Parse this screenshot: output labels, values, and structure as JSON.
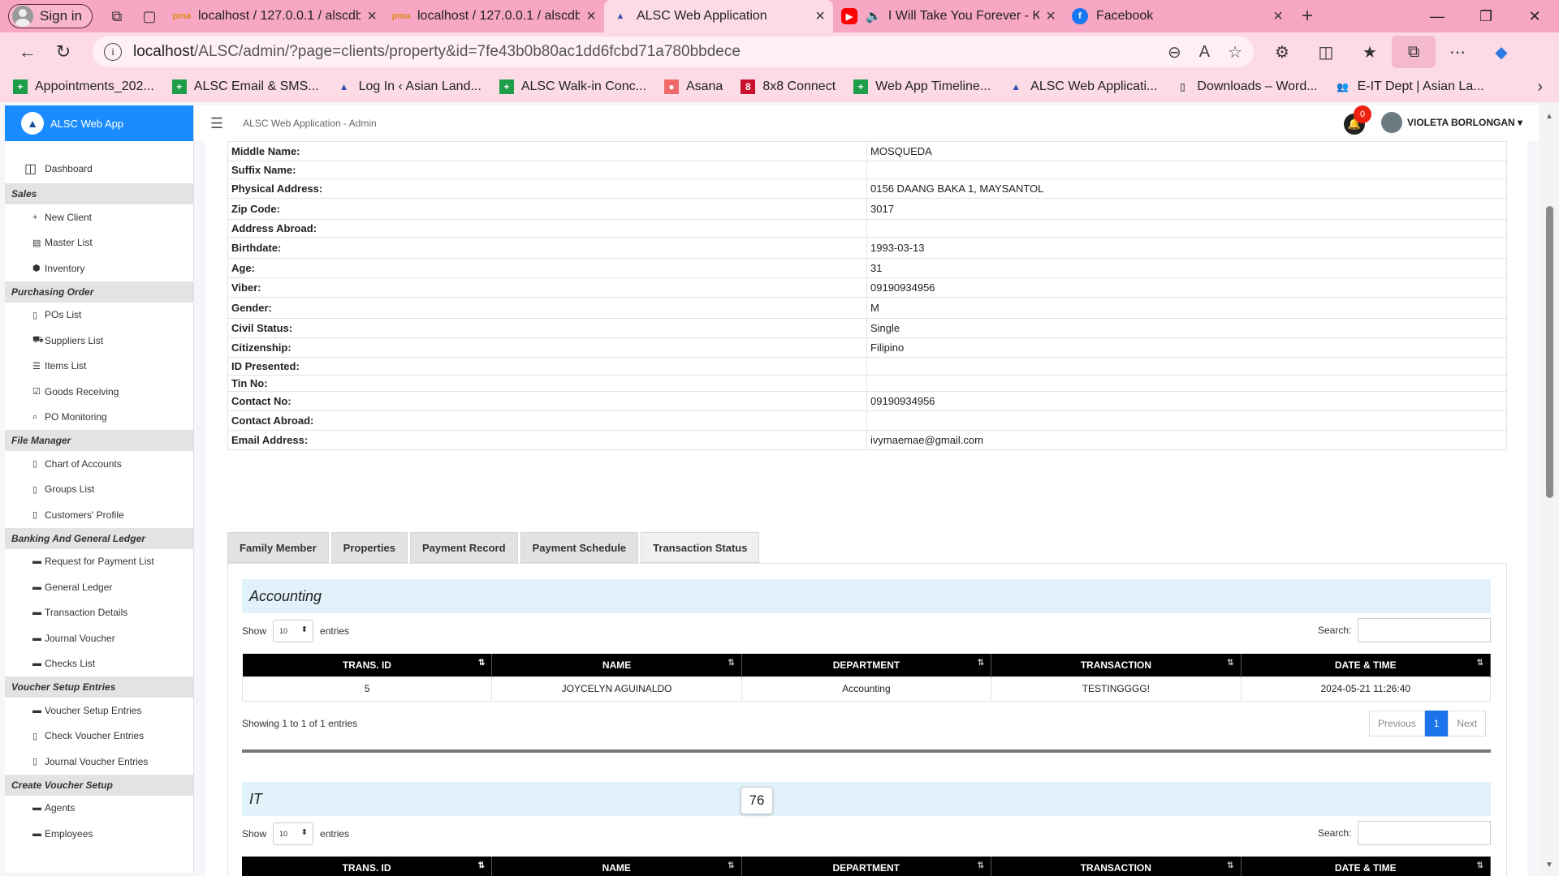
{
  "browser": {
    "signin_label": "Sign in",
    "tabs": [
      {
        "title": "localhost / 127.0.0.1 / alscdb /",
        "icon": "pma-icon"
      },
      {
        "title": "localhost / 127.0.0.1 / alscdb /",
        "icon": "pma-icon"
      },
      {
        "title": "ALSC Web Application",
        "icon": "alsc-icon",
        "active": true
      },
      {
        "title": "I Will Take You Forever - K",
        "icon": "youtube-icon"
      },
      {
        "title": "Facebook",
        "icon": "facebook-icon"
      }
    ],
    "url_host": "localhost",
    "url_path": "/ALSC/admin/?page=clients/property&id=7fe43b0b80ac1dd6fcbd71a780bbdece",
    "bookmarks": [
      {
        "label": "Appointments_202...",
        "color": "#1e9e48",
        "glyph": "+"
      },
      {
        "label": "ALSC Email & SMS...",
        "color": "#1e9e48",
        "glyph": "+"
      },
      {
        "label": "Log In ‹ Asian Land...",
        "color": "#3a4fb0",
        "glyph": "▲"
      },
      {
        "label": "ALSC Walk-in Conc...",
        "color": "#1e9e48",
        "glyph": "+"
      },
      {
        "label": "Asana",
        "color": "#f06a6a",
        "glyph": "●"
      },
      {
        "label": "8x8 Connect",
        "color": "#c8102e",
        "glyph": "8"
      },
      {
        "label": "Web App Timeline...",
        "color": "#1e9e48",
        "glyph": "+"
      },
      {
        "label": "ALSC Web Applicati...",
        "color": "#3a4fb0",
        "glyph": "▲"
      },
      {
        "label": "Downloads – Word...",
        "color": "#666",
        "glyph": "▯"
      },
      {
        "label": "E-IT Dept | Asian La...",
        "color": "#4a66d8",
        "glyph": "👥"
      }
    ]
  },
  "app": {
    "brand": "ALSC Web App",
    "top_title": "ALSC Web Application - Admin",
    "notif_count": "0",
    "user_name": "VIOLETA BORLONGAN ▾"
  },
  "sidebar": {
    "dashboard": "Dashboard",
    "sections": [
      {
        "title": "Sales",
        "items": [
          {
            "label": "New Client",
            "icon": "+"
          },
          {
            "label": "Master List",
            "icon": "▤"
          },
          {
            "label": "Inventory",
            "icon": "⬢"
          }
        ]
      },
      {
        "title": "Purchasing Order",
        "items": [
          {
            "label": "POs List",
            "icon": "▯"
          },
          {
            "label": "Suppliers List",
            "icon": "⛟"
          },
          {
            "label": "Items List",
            "icon": "☰"
          },
          {
            "label": "Goods Receiving",
            "icon": "☑"
          },
          {
            "label": "PO Monitoring",
            "icon": "⌕"
          }
        ]
      },
      {
        "title": "File Manager",
        "items": [
          {
            "label": "Chart of Accounts",
            "icon": "▯"
          },
          {
            "label": "Groups List",
            "icon": "▯"
          },
          {
            "label": "Customers' Profile",
            "icon": "▯"
          }
        ]
      },
      {
        "title": "Banking And General Ledger",
        "items": [
          {
            "label": "Request for Payment List",
            "icon": "▬"
          },
          {
            "label": "General Ledger",
            "icon": "▬"
          },
          {
            "label": "Transaction Details",
            "icon": "▬"
          },
          {
            "label": "Journal Voucher",
            "icon": "▬"
          },
          {
            "label": "Checks List",
            "icon": "▬"
          }
        ]
      },
      {
        "title": "Voucher Setup Entries",
        "items": [
          {
            "label": "Voucher Setup Entries",
            "icon": "▬"
          },
          {
            "label": "Check Voucher Entries",
            "icon": "▯"
          },
          {
            "label": "Journal Voucher Entries",
            "icon": "▯"
          }
        ]
      },
      {
        "title": "Create Voucher Setup",
        "items": [
          {
            "label": "Agents",
            "icon": "▬"
          },
          {
            "label": "Employees",
            "icon": "▬"
          }
        ]
      }
    ]
  },
  "client_details": [
    {
      "label": "Middle Name:",
      "value": "MOSQUEDA"
    },
    {
      "label": "Suffix Name:",
      "value": ""
    },
    {
      "label": "Physical Address:",
      "value": "0156 DAANG BAKA 1, MAYSANTOL"
    },
    {
      "label": "Zip Code:",
      "value": "3017"
    },
    {
      "label": "Address Abroad:",
      "value": ""
    },
    {
      "label": "Birthdate:",
      "value": "1993-03-13"
    },
    {
      "label": "Age:",
      "value": "31"
    },
    {
      "label": "Viber:",
      "value": "09190934956"
    },
    {
      "label": "Gender:",
      "value": "M"
    },
    {
      "label": "Civil Status:",
      "value": "Single"
    },
    {
      "label": "Citizenship:",
      "value": "Filipino"
    },
    {
      "label": "ID Presented:",
      "value": ""
    },
    {
      "label": "Tin No:",
      "value": ""
    },
    {
      "label": "Contact No:",
      "value": "09190934956"
    },
    {
      "label": "Contact Abroad:",
      "value": ""
    },
    {
      "label": "Email Address:",
      "value": "ivymaemae@gmail.com"
    }
  ],
  "tabs": [
    "Family Member",
    "Properties",
    "Payment Record",
    "Payment Schedule",
    "Transaction Status"
  ],
  "accounting": {
    "title": "Accounting",
    "show": "Show",
    "entries_value": "10",
    "entries": "entries",
    "search": "Search:",
    "columns": [
      "TRANS. ID",
      "NAME",
      "DEPARTMENT",
      "TRANSACTION",
      "DATE & TIME"
    ],
    "rows": [
      [
        "5",
        "JOYCELYN AGUINALDO",
        "Accounting",
        "TESTINGGGG!",
        "2024-05-21 11:26:40"
      ]
    ],
    "info": "Showing 1 to 1 of 1 entries",
    "prev": "Previous",
    "page": "1",
    "next": "Next"
  },
  "it": {
    "title": "IT",
    "show": "Show",
    "entries_value": "10",
    "entries": "entries",
    "search": "Search:",
    "columns": [
      "TRANS. ID",
      "NAME",
      "DEPARTMENT",
      "TRANSACTION",
      "DATE & TIME"
    ]
  },
  "tooltip": "76"
}
